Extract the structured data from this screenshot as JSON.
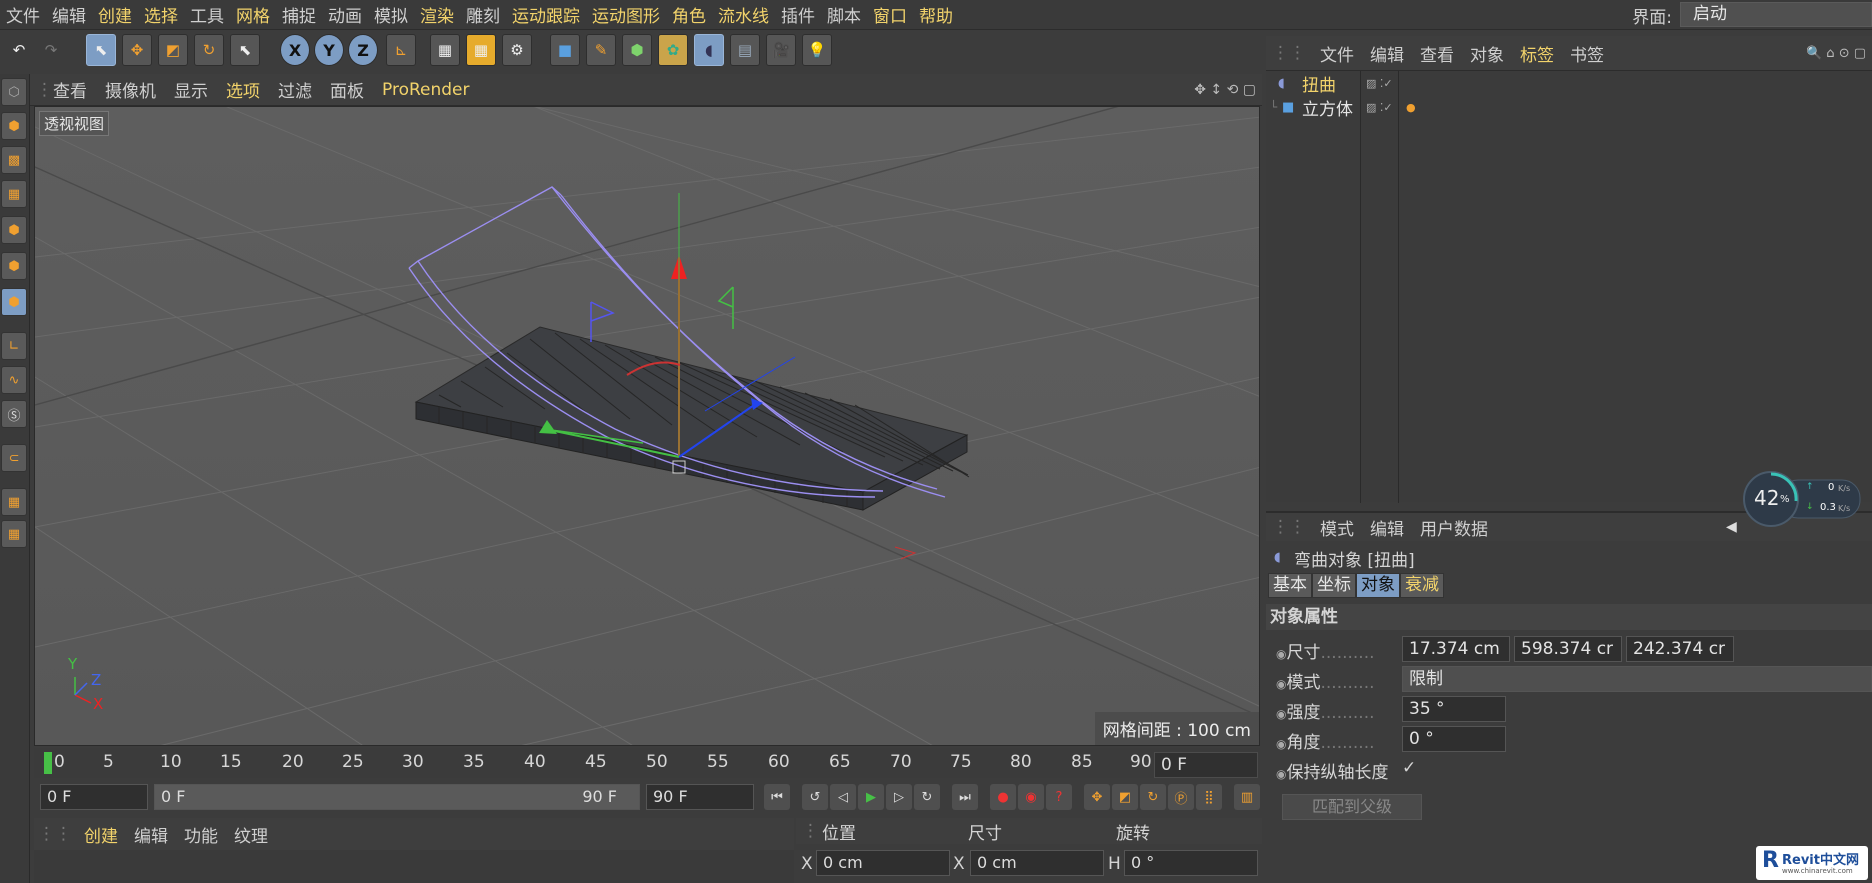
{
  "menubar": {
    "items": [
      "文件",
      "编辑",
      "创建",
      "选择",
      "工具",
      "网格",
      "捕捉",
      "动画",
      "模拟",
      "渲染",
      "雕刻",
      "运动跟踪",
      "运动图形",
      "角色",
      "流水线",
      "插件",
      "脚本",
      "窗口",
      "帮助"
    ],
    "layout_label": "界面:",
    "layout_value": "启动"
  },
  "toolbar": {
    "axis_x": "X",
    "axis_y": "Y",
    "axis_z": "Z"
  },
  "viewport": {
    "menu": [
      "查看",
      "摄像机",
      "显示",
      "选项",
      "过滤",
      "面板",
      "ProRender"
    ],
    "label": "透视视图",
    "grid_info": "网格间距 : 100 cm",
    "axis_y": "Y",
    "axis_z": "Z",
    "axis_x": "X"
  },
  "timeline": {
    "ticks": [
      "0",
      "5",
      "10",
      "15",
      "20",
      "25",
      "30",
      "35",
      "40",
      "45",
      "50",
      "55",
      "60",
      "65",
      "70",
      "75",
      "80",
      "85",
      "90"
    ],
    "current_frame": "0 F"
  },
  "transport": {
    "start": "0 F",
    "range_start": "0 F",
    "range_end": "90 F",
    "end": "90 F"
  },
  "materials": {
    "menu": [
      "创建",
      "编辑",
      "功能",
      "纹理"
    ]
  },
  "coords": {
    "headers": [
      "位置",
      "尺寸",
      "旋转"
    ],
    "x_label": "X",
    "position_x": "0 cm",
    "size_label": "X",
    "size_x": "0 cm",
    "rot_label": "H",
    "rotation_h": "0 °"
  },
  "object_manager": {
    "menu": [
      "文件",
      "编辑",
      "查看",
      "对象",
      "标签",
      "书签"
    ],
    "objects": [
      {
        "name": "扭曲"
      },
      {
        "name": "立方体"
      }
    ]
  },
  "attributes": {
    "menu": [
      "模式",
      "编辑",
      "用户数据"
    ],
    "object_title": "弯曲对象 [扭曲]",
    "tabs": [
      "基本",
      "坐标",
      "对象",
      "衰减"
    ],
    "section": "对象属性",
    "size_label": "尺寸",
    "size_values": [
      "17.374 cm",
      "598.374 cr",
      "242.374 cr"
    ],
    "mode_label": "模式",
    "mode_value": "限制",
    "strength_label": "强度",
    "strength_value": "35 °",
    "angle_label": "角度",
    "angle_value": "0 °",
    "keep_length_label": "保持纵轴长度",
    "keep_length_check": "✓",
    "fit_parent_button": "匹配到父级"
  },
  "badge": {
    "percent": "42",
    "unit": "%",
    "up": "0",
    "down": "0.3",
    "rate_unit": "K/s"
  },
  "watermark": {
    "brand": "Revit中文网",
    "url": "www.chinarevit.com"
  }
}
